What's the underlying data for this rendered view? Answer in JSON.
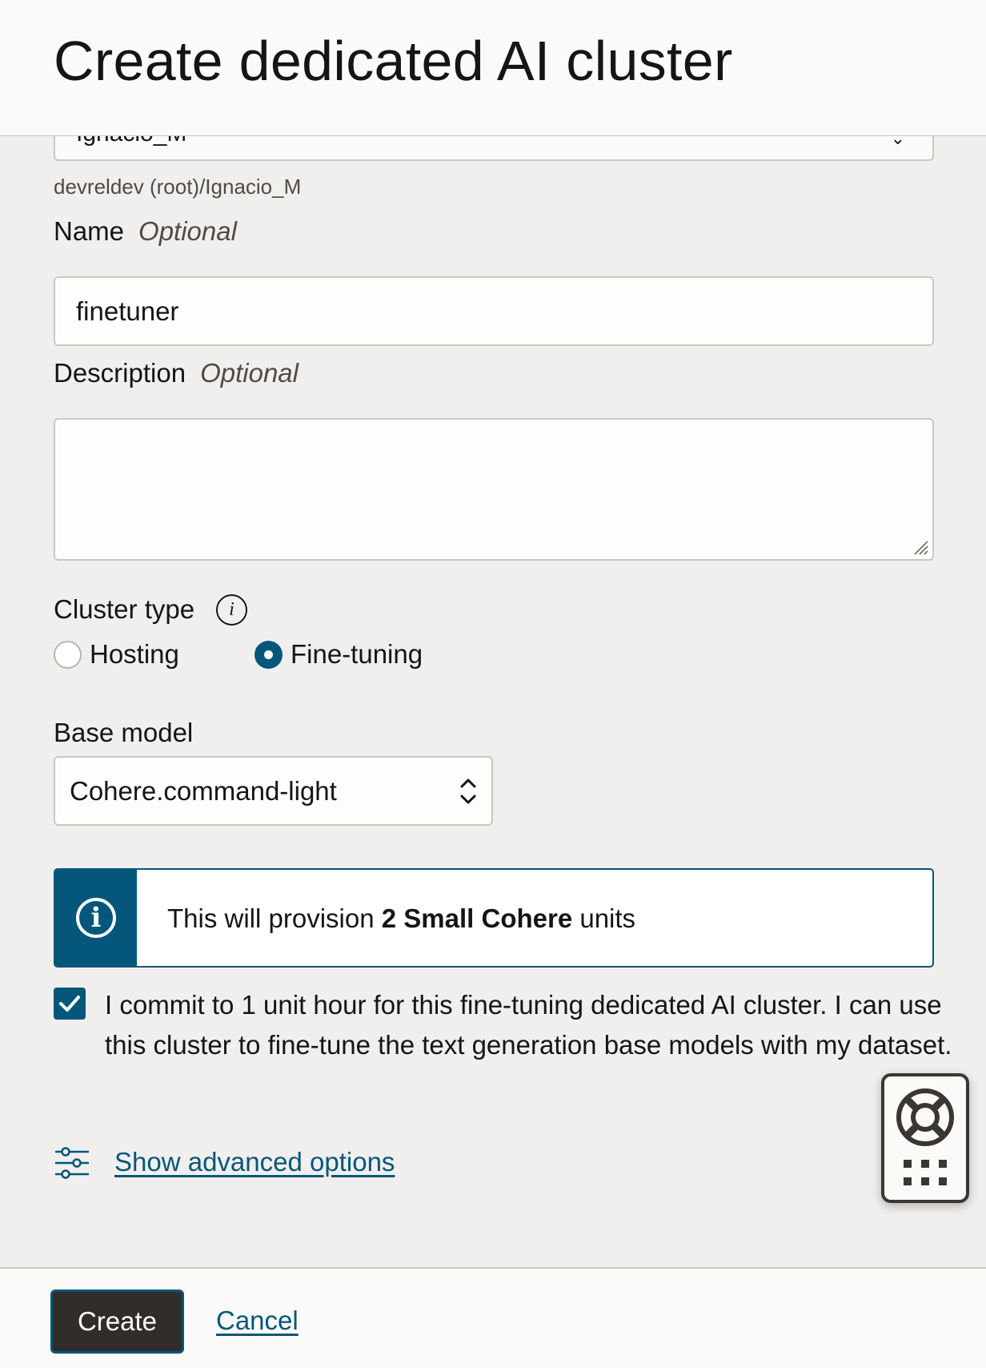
{
  "header": {
    "title": "Create dedicated AI cluster"
  },
  "compartment": {
    "value_cut": "Ignacio_M",
    "path_hint": "devreldev (root)/Ignacio_M"
  },
  "name_field": {
    "label": "Name",
    "optional": "Optional",
    "value": "finetuner"
  },
  "description_field": {
    "label": "Description",
    "optional": "Optional",
    "value": ""
  },
  "cluster_type": {
    "label": "Cluster type",
    "options": [
      {
        "label": "Hosting",
        "selected": false
      },
      {
        "label": "Fine-tuning",
        "selected": true
      }
    ]
  },
  "base_model": {
    "label": "Base model",
    "value": "Cohere.command-light"
  },
  "banner": {
    "prefix": "This will provision ",
    "bold": "2 Small Cohere",
    "suffix": " units"
  },
  "commitment": {
    "checked": true,
    "text": "I commit to 1 unit hour for this fine-tuning dedicated AI cluster. I can use this cluster to fine-tune the text generation base models with my dataset."
  },
  "advanced": {
    "link": "Show advanced options"
  },
  "footer": {
    "create": "Create",
    "cancel": "Cancel"
  },
  "colors": {
    "accent": "#04577b",
    "primary_button": "#312d2a",
    "background": "#f1efed"
  },
  "icons": [
    "chevron-down-icon",
    "info-icon",
    "resize-grip-icon",
    "spinner-arrows-icon",
    "checkmark-icon",
    "sliders-icon",
    "lifebuoy-icon",
    "grid-dots-icon"
  ]
}
